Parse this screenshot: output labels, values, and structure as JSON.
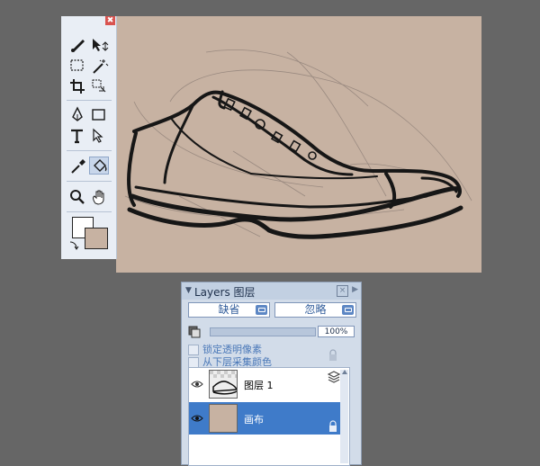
{
  "toolbox": {
    "close_glyph": "✖",
    "tools": [
      "brush-tool",
      "move-tool",
      "marquee-tool",
      "magic-wand-tool",
      "crop-tool",
      "transform-tool",
      "pen-tool",
      "shape-tool",
      "text-tool",
      "selection-arrow-tool",
      "eyedropper-tool",
      "paint-bucket-tool",
      "zoom-tool",
      "hand-tool"
    ],
    "foreground_color": "#ffffff",
    "background_color": "#c7b2a2"
  },
  "canvas": {
    "background_color": "#c7b2a2"
  },
  "layers_panel": {
    "title": "Layers 图层",
    "blend_mode": "缺省",
    "composite": "忽略",
    "opacity": "100%",
    "lock_transparency_label": "锁定透明像素",
    "sample_below_label": "从下层采集颜色",
    "layers": [
      {
        "name": "图层  1",
        "selected": false
      },
      {
        "name": "画布",
        "selected": true
      }
    ]
  }
}
